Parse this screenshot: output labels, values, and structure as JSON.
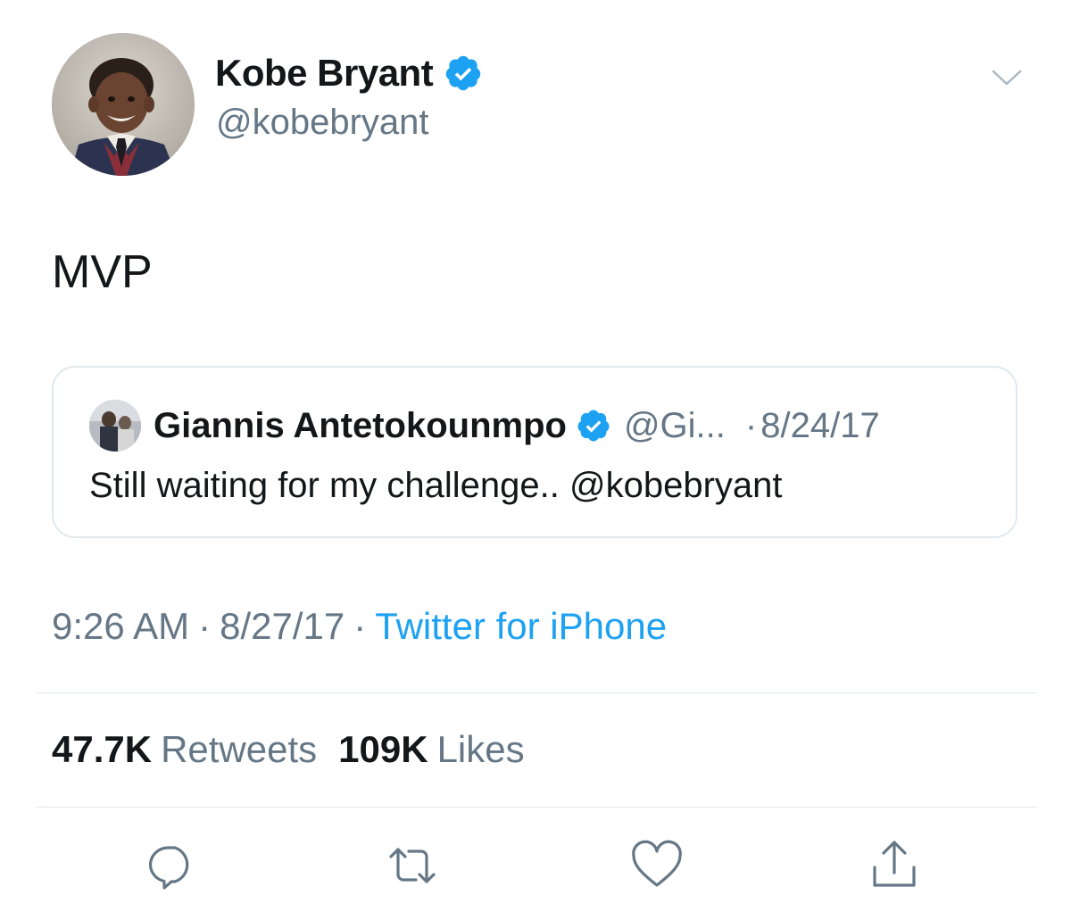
{
  "author": {
    "display_name": "Kobe Bryant",
    "handle": "@kobebryant",
    "verified": true
  },
  "tweet": {
    "text": "MVP",
    "time": "9:26 AM",
    "date": "8/27/17",
    "source": "Twitter for iPhone",
    "separator": "·"
  },
  "quoted_tweet": {
    "display_name": "Giannis Antetokounmpo",
    "handle": "@Gi...",
    "separator": "·",
    "date": "8/24/17",
    "text": "Still waiting for my challenge.. @kobebryant",
    "verified": true
  },
  "stats": {
    "retweets_count": "47.7K",
    "retweets_label": "Retweets",
    "likes_count": "109K",
    "likes_label": "Likes"
  },
  "icons": {
    "menu": "chevron-down-icon",
    "reply": "reply-icon",
    "retweet": "retweet-icon",
    "like": "heart-icon",
    "share": "share-icon",
    "verified": "verified-badge-icon"
  },
  "colors": {
    "verified_blue": "#1da1f2",
    "link_blue": "#1da1f2",
    "secondary_text": "#657786",
    "primary_text": "#14171a",
    "border": "#e1e8ed"
  }
}
